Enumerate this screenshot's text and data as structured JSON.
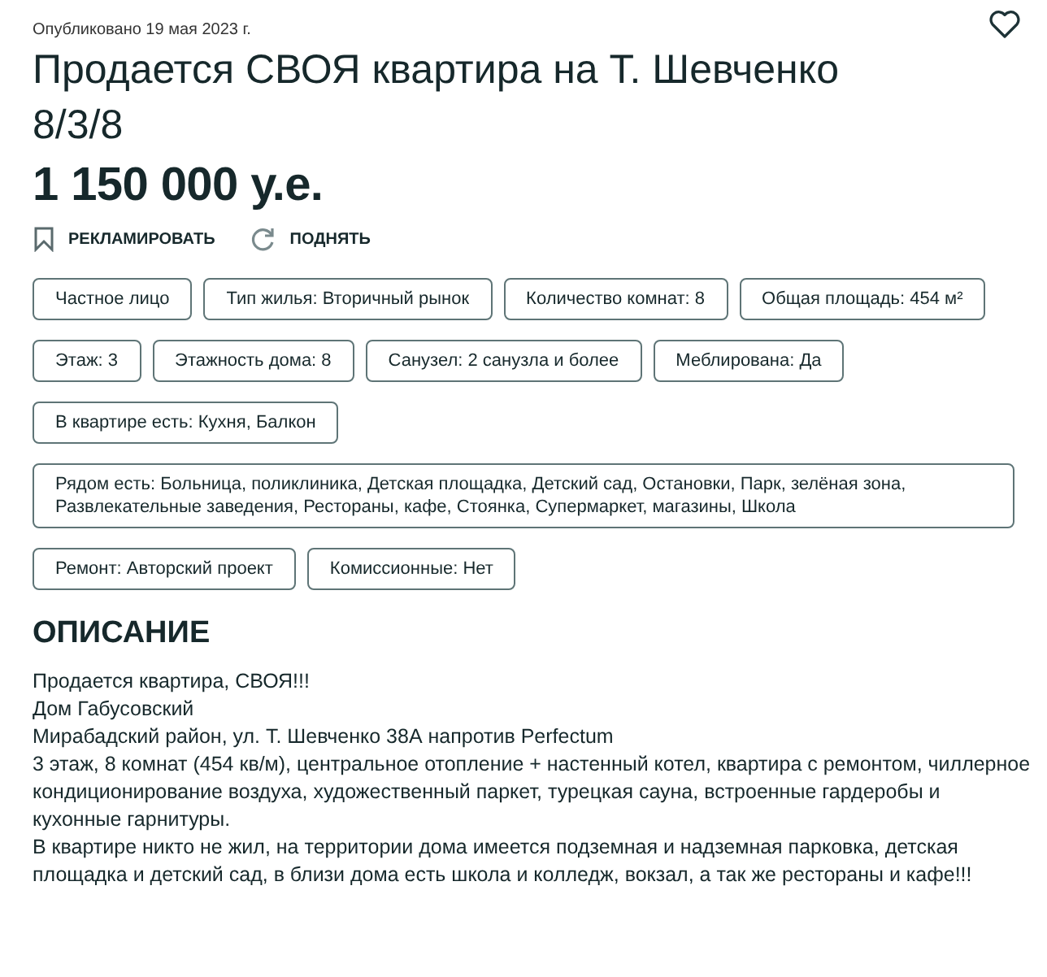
{
  "published": "Опубликовано 19 мая 2023 г.",
  "favorite": {
    "selected": false
  },
  "title": "Продается СВОЯ квартира на Т. Шевченко 8/3/8",
  "price": "1 150 000 у.е.",
  "actions": [
    {
      "kind": "bookmark",
      "label": "РЕКЛАМИРОВАТЬ"
    },
    {
      "kind": "refresh",
      "label": "ПОДНЯТЬ"
    }
  ],
  "features": [
    [
      "Частное лицо",
      "Тип жилья: Вторичный рынок",
      "Количество комнат: 8",
      "Общая площадь: 454 м²"
    ],
    [
      "Этаж: 3",
      "Этажность дома: 8",
      "Санузел: 2 санузла и более",
      "Меблирована: Да"
    ],
    [
      "В квартире есть: Кухня, Балкон"
    ],
    [
      "Рядом есть: Больница, поликлиника, Детская площадка, Детский сад, Остановки, Парк, зелёная зона, Развлекательные заведения, Рестораны, кафе, Стоянка, Супермаркет, магазины, Школа"
    ],
    [
      "Ремонт: Авторский проект",
      "Комиссионные: Нет"
    ]
  ],
  "description": {
    "heading": "ОПИСАНИЕ",
    "paragraphs": [
      "Продается квартира, СВОЯ!!!",
      "Дом Габусовский",
      "Мирабадский район, ул. Т. Шевченко 38А напротив Perfectum",
      "3 этаж, 8 комнат (454 кв/м), центральное отопление + настенный котел, квартира с ремонтом, чиллерное кондиционирование воздуха, художественный паркет, турецкая сауна, встроенные гардеробы и кухонные гарнитуры.",
      "В квартире никто не жил, на территории дома имеется подземная и надземная парковка, детская площадка и детский сад, в близи дома есть школа и колледж, вокзал, а так же рестораны и кафе!!!"
    ]
  }
}
